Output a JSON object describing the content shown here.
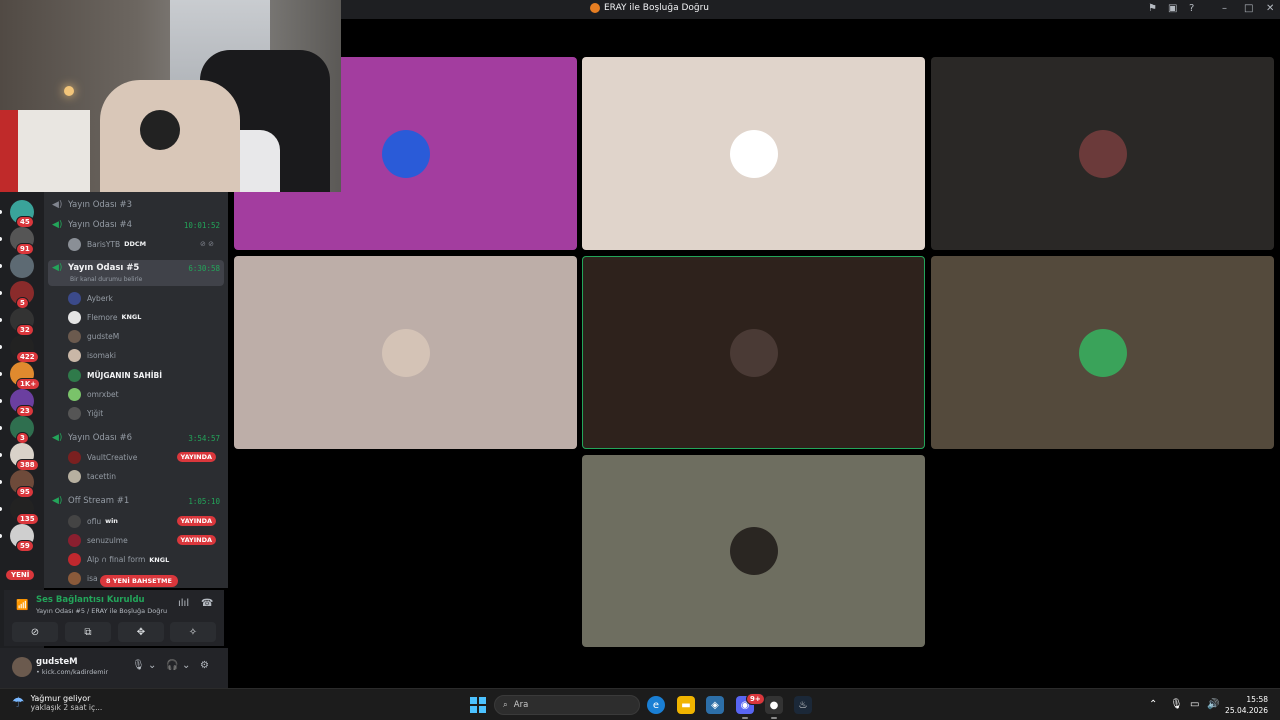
{
  "window": {
    "title": "ERAY ile Boşluğa Doğru"
  },
  "titlebar_icons": [
    "pin-icon",
    "inbox-icon",
    "help-icon",
    "minimize-icon",
    "maximize-icon",
    "close-icon"
  ],
  "servers": [
    {
      "badge": "45",
      "color": "#3aa39a"
    },
    {
      "badge": "91",
      "color": "#555555"
    },
    {
      "badge": "",
      "color": "#5d6a73"
    },
    {
      "badge": "5",
      "color": "#8a2b2b"
    },
    {
      "badge": "32",
      "color": "#333333"
    },
    {
      "badge": "422",
      "color": "#222222"
    },
    {
      "badge": "1K+",
      "color": "#e08a2e"
    },
    {
      "badge": "23",
      "color": "#6b3fa0"
    },
    {
      "badge": "3",
      "color": "#2f6f4f"
    },
    {
      "badge": "388",
      "color": "#d9d2c9"
    },
    {
      "badge": "95",
      "color": "#6e4a3a"
    },
    {
      "badge": "135",
      "color": "#222222"
    },
    {
      "badge": "59",
      "color": "#cfcfcf"
    }
  ],
  "rail": {
    "new_label": "YENİ"
  },
  "channels": {
    "rooms": [
      {
        "name": "Yayın Odası #3",
        "timer": ""
      },
      {
        "name": "Yayın Odası #4",
        "timer": "10:01:52"
      },
      {
        "name": "Yayın Odası #5",
        "timer": "6:30:58",
        "status": "Bir kanal durumu belirle"
      },
      {
        "name": "Yayın Odası #6",
        "timer": "3:54:57"
      },
      {
        "name": "Off Stream #1",
        "timer": "1:05:10"
      }
    ],
    "room4_users": [
      {
        "name": "BarisYTB",
        "tag": "DDCM",
        "color": "#8a8f96"
      }
    ],
    "room5_users": [
      {
        "name": "Ayberk",
        "color": "#3b4a8a"
      },
      {
        "name": "Flemore",
        "tag": "KNGL",
        "color": "#e4e4e4"
      },
      {
        "name": "gudsteM",
        "color": "#6b5a4e"
      },
      {
        "name": "isomaki",
        "color": "#c9b7a7"
      },
      {
        "name": "MÜJGANIN SAHİBİ",
        "color": "#2f7a4a"
      },
      {
        "name": "omrxbet",
        "color": "#7ac36a"
      },
      {
        "name": "Yiğit",
        "color": "#555555"
      }
    ],
    "room6_users": [
      {
        "name": "VaultCreative",
        "color": "#7a2020",
        "live": "YAYINDA"
      },
      {
        "name": "tacettin",
        "color": "#b7b0a0"
      }
    ],
    "off_users": [
      {
        "name": "oflu",
        "tag": "win",
        "color": "#444444",
        "live": "YAYINDA"
      },
      {
        "name": "senuzulme",
        "color": "#8a1f2f",
        "live": "YAYINDA"
      },
      {
        "name": "Alp ∩ final form",
        "tag": "KNGL",
        "color": "#c0282e"
      },
      {
        "name": "isa",
        "color": "#8a5a3a"
      }
    ],
    "new_mentions": "8 YENİ BAHSETME"
  },
  "voice": {
    "status": "Ses Bağlantısı Kuruldu",
    "location": "Yayın Odası #5 / ERAY ile Boşluğa Doğru"
  },
  "user_panel": {
    "name": "gudsteM",
    "subtitle": "• kick.com/kadirdemir"
  },
  "grid": [
    {
      "bg": "#a33d9f",
      "avatar": "#2a5bd8",
      "speaking": false
    },
    {
      "bg": "#e0d4cb",
      "avatar": "#ffffff",
      "speaking": false
    },
    {
      "bg": "#2a2826",
      "avatar": "#6b3a3a",
      "speaking": false
    },
    {
      "bg": "#bdaea8",
      "avatar": "#d4c3b6",
      "speaking": false
    },
    {
      "bg": "#2e221c",
      "avatar": "#4a3a35",
      "speaking": true
    },
    {
      "bg": "#544a3c",
      "avatar": "#3aa35a",
      "speaking": false
    },
    {
      "bg": "#6e6e60",
      "avatar": "#2a2622",
      "speaking": false
    }
  ],
  "taskbar": {
    "weather_title": "Yağmur geliyor",
    "weather_sub": "yaklaşık 2 saat iç...",
    "search_placeholder": "Ara",
    "discord_badge": "9+",
    "time": "15:58",
    "date": "25.04.2026"
  }
}
